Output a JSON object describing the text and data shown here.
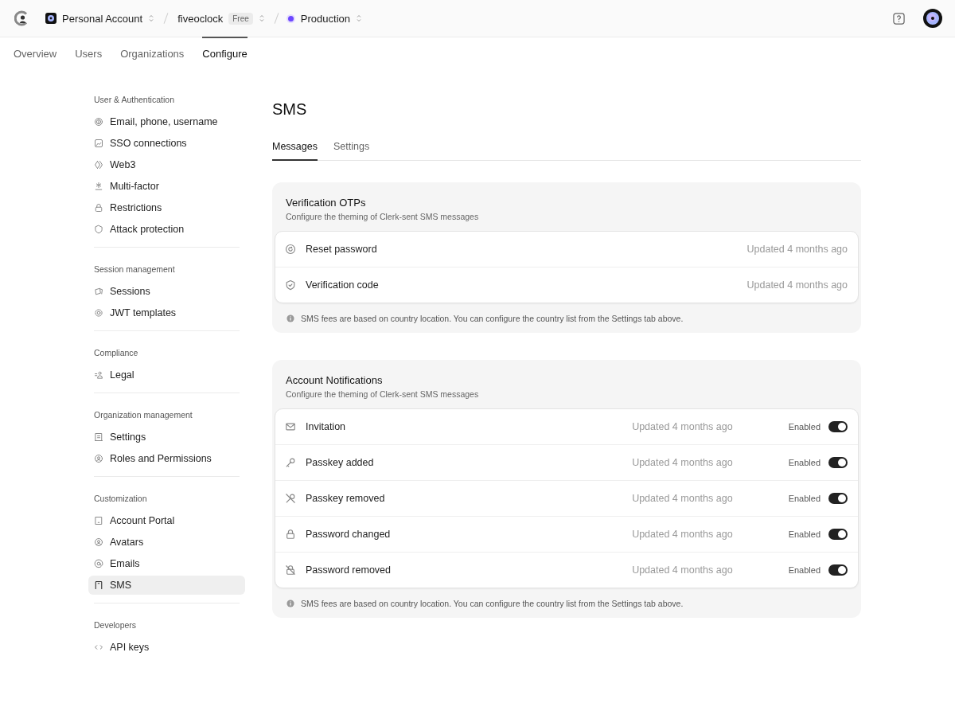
{
  "topbar": {
    "breadcrumbs": [
      {
        "label": "Personal Account",
        "kind": "account"
      },
      {
        "label": "fiveoclock",
        "badge": "Free",
        "kind": "app"
      },
      {
        "label": "Production",
        "kind": "instance"
      }
    ]
  },
  "nav": {
    "tabs": [
      {
        "label": "Overview",
        "selected": false
      },
      {
        "label": "Users",
        "selected": false
      },
      {
        "label": "Organizations",
        "selected": false
      },
      {
        "label": "Configure",
        "selected": true
      }
    ]
  },
  "sidebar": {
    "sections": [
      {
        "title": "User & Authentication",
        "items": [
          {
            "label": "Email, phone, username",
            "selected": false
          },
          {
            "label": "SSO connections",
            "selected": false
          },
          {
            "label": "Web3",
            "selected": false
          },
          {
            "label": "Multi-factor",
            "selected": false
          },
          {
            "label": "Restrictions",
            "selected": false
          },
          {
            "label": "Attack protection",
            "selected": false
          }
        ]
      },
      {
        "title": "Session management",
        "items": [
          {
            "label": "Sessions",
            "selected": false
          },
          {
            "label": "JWT templates",
            "selected": false
          }
        ]
      },
      {
        "title": "Compliance",
        "items": [
          {
            "label": "Legal",
            "selected": false
          }
        ]
      },
      {
        "title": "Organization management",
        "items": [
          {
            "label": "Settings",
            "selected": false
          },
          {
            "label": "Roles and Permissions",
            "selected": false
          }
        ]
      },
      {
        "title": "Customization",
        "items": [
          {
            "label": "Account Portal",
            "selected": false
          },
          {
            "label": "Avatars",
            "selected": false
          },
          {
            "label": "Emails",
            "selected": false
          },
          {
            "label": "SMS",
            "selected": true
          }
        ]
      },
      {
        "title": "Developers",
        "items": [
          {
            "label": "API keys",
            "selected": false
          }
        ]
      }
    ]
  },
  "page": {
    "title": "SMS",
    "tabs": [
      {
        "label": "Messages",
        "selected": true
      },
      {
        "label": "Settings",
        "selected": false
      }
    ],
    "cards": [
      {
        "title": "Verification OTPs",
        "subtitle": "Configure the theming of Clerk-sent SMS messages",
        "rows": [
          {
            "name": "Reset password",
            "updated": "Updated 4 months ago"
          },
          {
            "name": "Verification code",
            "updated": "Updated 4 months ago"
          }
        ],
        "note": "SMS fees are based on country location. You can configure the country list from the Settings tab above."
      },
      {
        "title": "Account Notifications",
        "subtitle": "Configure the theming of Clerk-sent SMS messages",
        "rows": [
          {
            "name": "Invitation",
            "updated": "Updated 4 months ago",
            "status": "Enabled",
            "on": true
          },
          {
            "name": "Passkey added",
            "updated": "Updated 4 months ago",
            "status": "Enabled",
            "on": true
          },
          {
            "name": "Passkey removed",
            "updated": "Updated 4 months ago",
            "status": "Enabled",
            "on": true
          },
          {
            "name": "Password changed",
            "updated": "Updated 4 months ago",
            "status": "Enabled",
            "on": true
          },
          {
            "name": "Password removed",
            "updated": "Updated 4 months ago",
            "status": "Enabled",
            "on": true
          }
        ],
        "note": "SMS fees are based on country location. You can configure the country list from the Settings tab above."
      }
    ]
  }
}
